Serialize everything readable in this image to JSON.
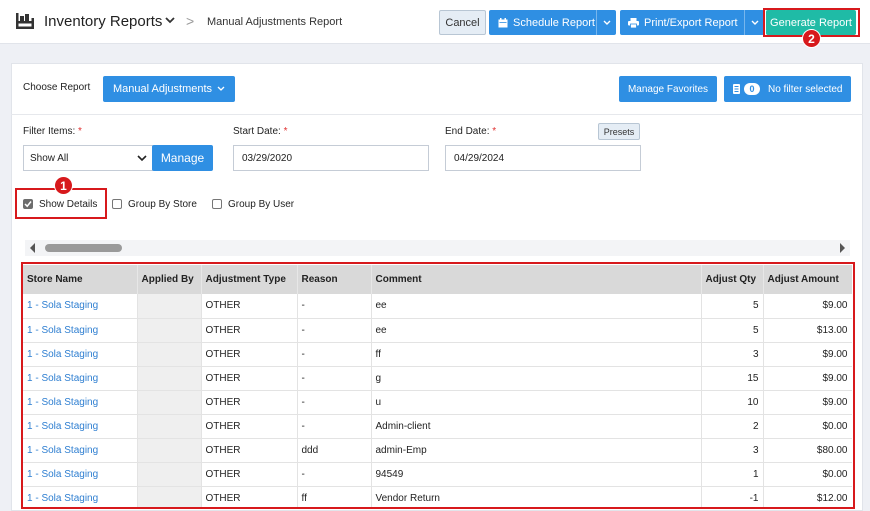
{
  "header": {
    "app_title": "Inventory Reports",
    "breadcrumb_sep": ">",
    "page": "Manual Adjustments Report",
    "cancel_label": "Cancel",
    "schedule_label": "Schedule Report",
    "print_label": "Print/Export Report",
    "generate_label": "Generate Report"
  },
  "markers": {
    "one": "1",
    "two": "2"
  },
  "controls": {
    "choose_report_label": "Choose Report",
    "report_select": "Manual Adjustments",
    "manage_favorites": "Manage Favorites",
    "filter_count": "0",
    "filter_status": "No filter selected",
    "filter_items_label": "Filter Items:",
    "required_mark": "*",
    "filter_items_value": "Show All",
    "manage_label": "Manage",
    "start_date_label": "Start Date:",
    "start_date": "03/29/2020",
    "end_date_label": "End Date:",
    "end_date": "04/29/2024",
    "presets_label": "Presets",
    "show_details": "Show Details",
    "group_by_store": "Group By Store",
    "group_by_user": "Group By User"
  },
  "table": {
    "columns": [
      "Store Name",
      "Applied By",
      "Adjustment Type",
      "Reason",
      "Comment",
      "Adjust Qty",
      "Adjust Amount"
    ],
    "rows": [
      [
        "1 - Sola Staging",
        "",
        "OTHER",
        "-",
        "ee",
        "5",
        "$9.00"
      ],
      [
        "1 - Sola Staging",
        "",
        "OTHER",
        "-",
        "ee",
        "5",
        "$13.00"
      ],
      [
        "1 - Sola Staging",
        "",
        "OTHER",
        "-",
        "ff",
        "3",
        "$9.00"
      ],
      [
        "1 - Sola Staging",
        "",
        "OTHER",
        "-",
        "g",
        "15",
        "$9.00"
      ],
      [
        "1 - Sola Staging",
        "",
        "OTHER",
        "-",
        "u",
        "10",
        "$9.00"
      ],
      [
        "1 - Sola Staging",
        "",
        "OTHER",
        "-",
        "Admin-client",
        "2",
        "$0.00"
      ],
      [
        "1 - Sola Staging",
        "",
        "OTHER",
        "ddd",
        "admin-Emp",
        "3",
        "$80.00"
      ],
      [
        "1 - Sola Staging",
        "",
        "OTHER",
        "-",
        "94549",
        "1",
        "$0.00"
      ],
      [
        "1 - Sola Staging",
        "",
        "OTHER",
        "ff",
        "Vendor Return",
        "-1",
        "$12.00"
      ]
    ]
  }
}
